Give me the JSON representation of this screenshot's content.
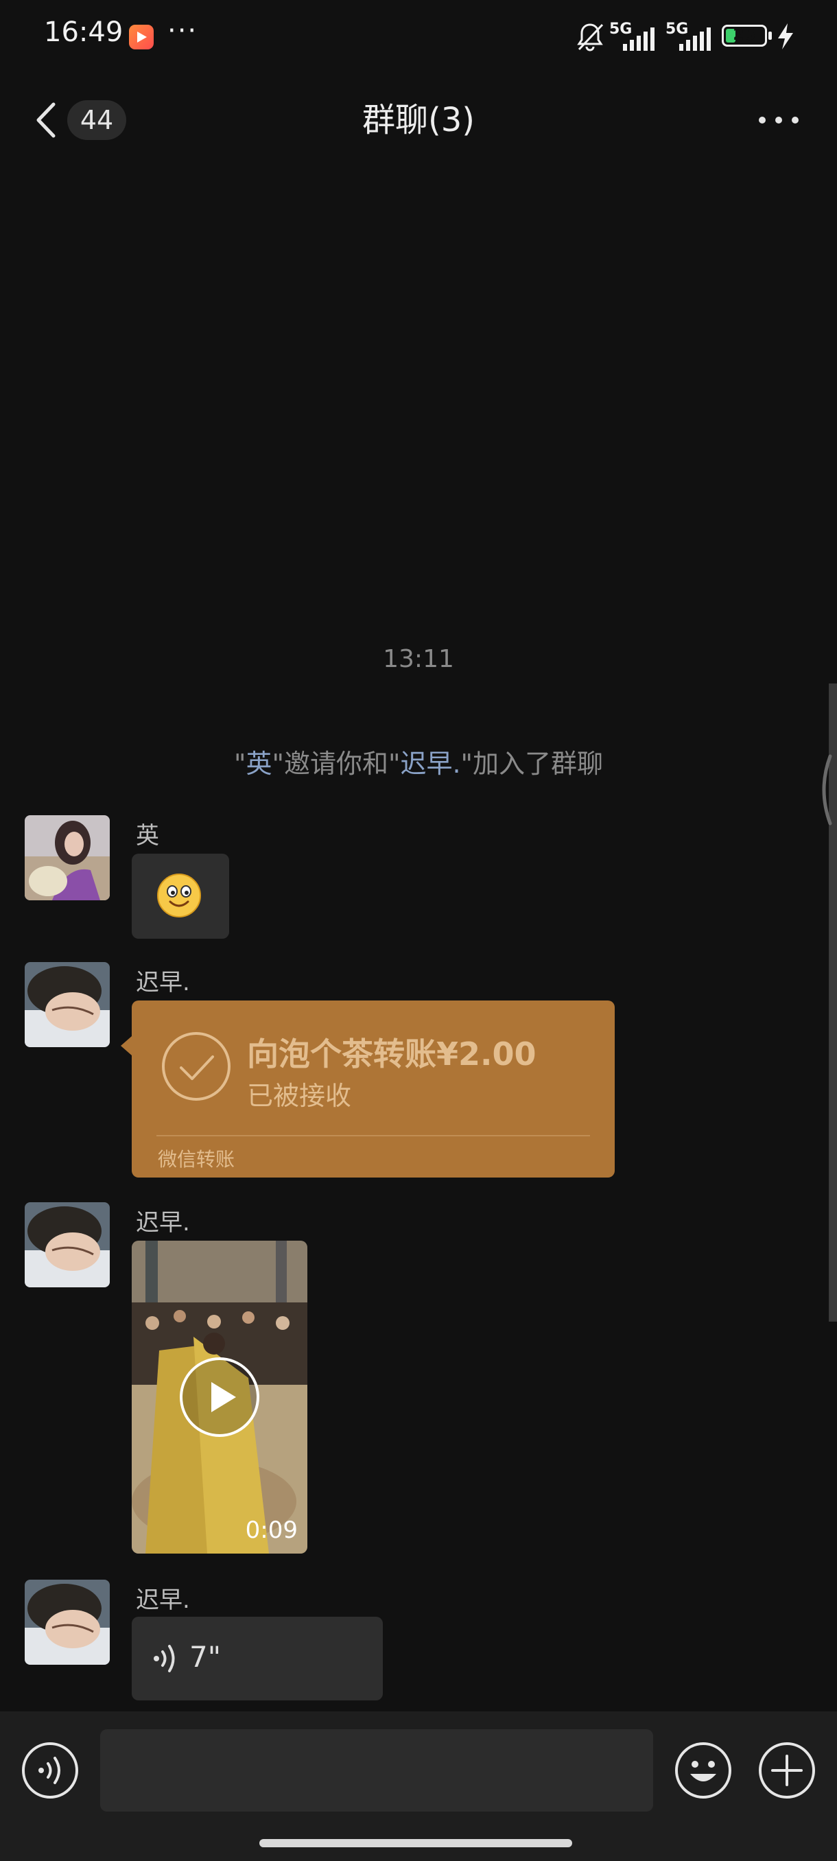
{
  "status_bar": {
    "time": "16:49",
    "more": "···",
    "sim1_label": "5G",
    "sim2_label": "5G",
    "battery_level": "25",
    "battery_fraction": 0.25,
    "icons": [
      "app-notification-icon",
      "mute-bell-icon",
      "signal-icon",
      "battery-icon",
      "charging-icon"
    ]
  },
  "header": {
    "unread_count": "44",
    "title": "群聊(3)",
    "icons": [
      "back-arrow-icon",
      "more-dots-icon"
    ]
  },
  "messages": {
    "timestamp": "13:11",
    "system": {
      "q1": "\"",
      "inviter": "英",
      "mid": "\"邀请你和\"",
      "invitee": "迟早.",
      "tail": "\"加入了群聊"
    },
    "msg1": {
      "sender": "英",
      "content": "emoji-smile"
    },
    "msg2": {
      "sender": "迟早.",
      "transfer_title": "向泡个茶转账¥2.00",
      "transfer_status": "已被接收",
      "transfer_label": "微信转账"
    },
    "msg3": {
      "sender": "迟早.",
      "video_duration": "0:09"
    },
    "msg4": {
      "sender": "迟早.",
      "voice_duration": "7\""
    }
  },
  "input_bar": {
    "placeholder": "",
    "icons": [
      "voice-input-icon",
      "emoji-icon",
      "plus-icon"
    ]
  },
  "colors": {
    "background": "#111111",
    "transfer_card": "#ae7536",
    "bubble": "#2e2e2e",
    "link_name": "#8aa2c7"
  }
}
